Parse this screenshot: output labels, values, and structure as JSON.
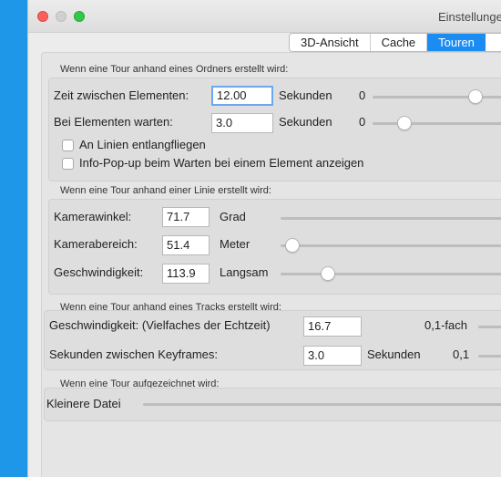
{
  "window": {
    "title": "Einstellungen",
    "tabs": [
      {
        "label": "3D-Ansicht",
        "active": false
      },
      {
        "label": "Cache",
        "active": false
      },
      {
        "label": "Touren",
        "active": true
      }
    ]
  },
  "folder_tour": {
    "legend": "Wenn eine Tour anhand eines Ordners erstellt wird:",
    "time_between": {
      "label": "Zeit zwischen Elementen:",
      "value": "12.00",
      "unit": "Sekunden",
      "min_label": "0",
      "slider_fraction": 0.75
    },
    "wait_at": {
      "label": "Bei Elementen warten:",
      "value": "3.0",
      "unit": "Sekunden",
      "min_label": "0",
      "slider_fraction": 0.22
    },
    "fly_along_lines": {
      "label": "An Linien entlangfliegen",
      "checked": false
    },
    "show_popup": {
      "label": "Info-Pop-up beim Warten bei einem Element anzeigen",
      "checked": false
    }
  },
  "line_tour": {
    "legend": "Wenn eine Tour anhand einer Linie erstellt wird:",
    "camera_angle": {
      "label": "Kamerawinkel:",
      "value": "71.7",
      "unit": "Grad"
    },
    "camera_range": {
      "label": "Kamerabereich:",
      "value": "51.4",
      "unit": "Meter"
    },
    "speed": {
      "label": "Geschwindigkeit:",
      "value": "113.9",
      "unit": "Langsam"
    }
  },
  "track_tour": {
    "legend": "Wenn eine Tour anhand eines Tracks erstellt wird:",
    "speed": {
      "label": "Geschwindigkeit: (Vielfaches der Echtzeit)",
      "value": "16.7",
      "min_label": "0,1-fach"
    },
    "keyframes": {
      "label": "Sekunden zwischen Keyframes:",
      "value": "3.0",
      "unit": "Sekunden",
      "min_label": "0,1"
    }
  },
  "recorded_tour": {
    "legend": "Wenn eine Tour aufgezeichnet wird:",
    "size": {
      "label": "Kleinere Datei"
    }
  },
  "colors": {
    "accent": "#1b8cf2",
    "side_bar": "#1f97e8",
    "focus_ring": "#6aa8ef"
  }
}
